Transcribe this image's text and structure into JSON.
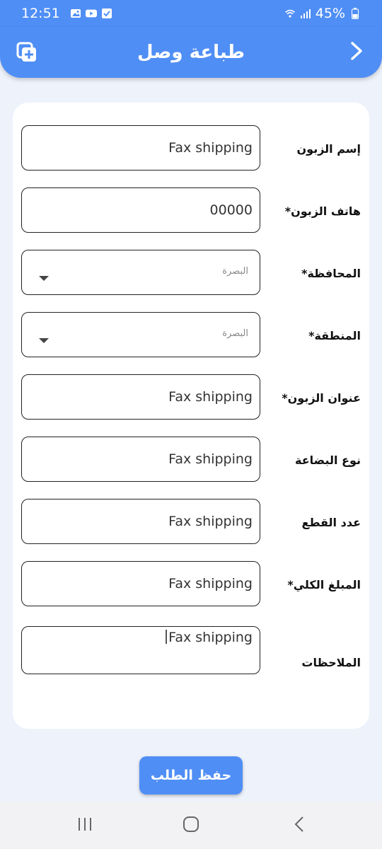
{
  "status_bar": {
    "time": "12:51",
    "battery": "45%",
    "icons_left": [
      "gallery-icon",
      "youtube-icon",
      "check-box-icon"
    ],
    "icons_right": [
      "wifi-icon",
      "signal-icon",
      "battery-icon"
    ]
  },
  "app_bar": {
    "title": "طباعة وصل",
    "back_icon": "chevron-right-icon",
    "add_icon": "add-copy-icon"
  },
  "form": {
    "fields": [
      {
        "label": "إسم الزبون",
        "value": "Fax shipping",
        "type": "text"
      },
      {
        "label": "هاتف الزبون*",
        "value": "00000",
        "type": "text"
      },
      {
        "label": "المحافظة*",
        "value": "البصرة",
        "type": "select"
      },
      {
        "label": "المنطقة*",
        "value": "البصرة",
        "type": "select"
      },
      {
        "label": "عنوان الزبون*",
        "value": "Fax shipping",
        "type": "text"
      },
      {
        "label": "نوع البضاعة",
        "value": "Fax shipping",
        "type": "text"
      },
      {
        "label": "عدد القطع",
        "value": "Fax shipping",
        "type": "text"
      },
      {
        "label": "المبلغ الكلي*",
        "value": "Fax shipping",
        "type": "text"
      },
      {
        "label": "الملاحظات",
        "value": "Fax shipping",
        "type": "textarea"
      }
    ]
  },
  "save_button": {
    "label": "حفظ الطلب"
  },
  "nav_bar": {
    "icons": [
      "recent-apps-icon",
      "home-icon",
      "back-icon"
    ]
  },
  "colors": {
    "primary": "#4f8ef5",
    "background": "#eef2fb",
    "card": "#ffffff"
  }
}
